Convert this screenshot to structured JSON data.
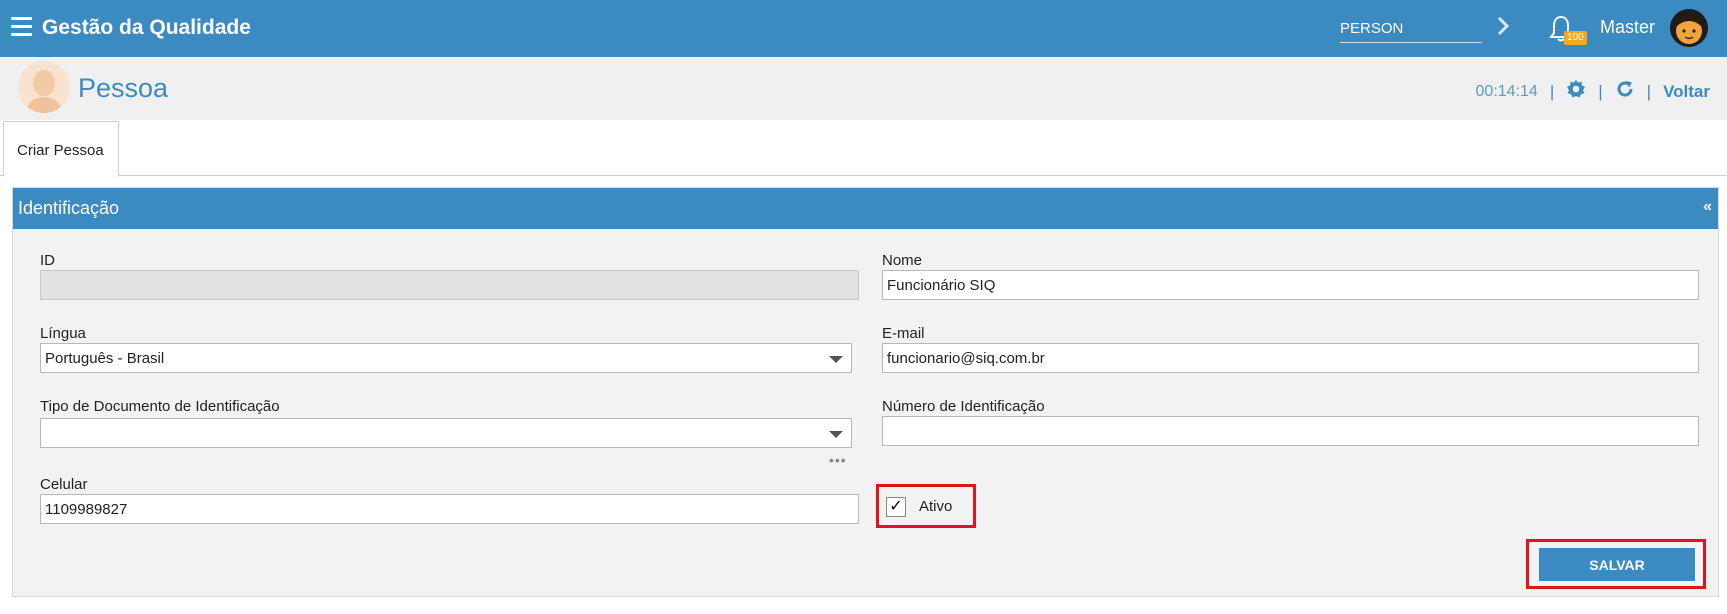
{
  "topbar": {
    "app_title": "Gestão da Qualidade",
    "search_value": "PERSON",
    "notification_count": "100",
    "user_name": "Master"
  },
  "header": {
    "page_title": "Pessoa",
    "timer": "00:14:14",
    "back_label": "Voltar"
  },
  "tabs": [
    {
      "label": "Criar Pessoa"
    }
  ],
  "panel": {
    "title": "Identificação",
    "collapse_glyph": "«"
  },
  "form": {
    "id": {
      "label": "ID",
      "value": ""
    },
    "nome": {
      "label": "Nome",
      "value": "Funcionário SIQ"
    },
    "lingua": {
      "label": "Língua",
      "value": "Português - Brasil"
    },
    "email": {
      "label": "E-mail",
      "value": "funcionario@siq.com.br"
    },
    "tipo_documento": {
      "label": "Tipo de Documento de Identificação",
      "value": ""
    },
    "numero_identificacao": {
      "label": "Número de Identificação",
      "value": ""
    },
    "celular": {
      "label": "Celular",
      "value": "1109989827"
    },
    "ativo": {
      "label": "Ativo",
      "checked": true,
      "check_glyph": "✓"
    },
    "more_glyph": "•••"
  },
  "actions": {
    "save_label": "SALVAR"
  },
  "colors": {
    "primary": "#3b8bc2",
    "highlight": "#e0141c",
    "badge": "#f5a623"
  }
}
